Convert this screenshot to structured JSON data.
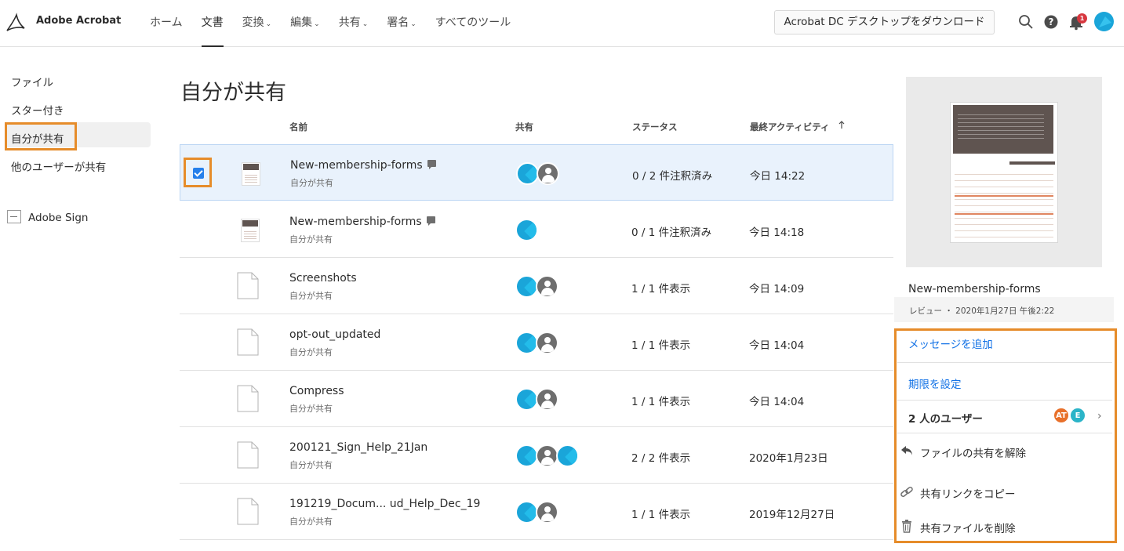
{
  "app": {
    "brand": "Adobe Acrobat",
    "logo_icon": "acrobat-logo-icon"
  },
  "nav": {
    "items": [
      {
        "label": "ホーム",
        "has_dropdown": false,
        "active": false
      },
      {
        "label": "文書",
        "has_dropdown": false,
        "active": true
      },
      {
        "label": "変換",
        "has_dropdown": true,
        "active": false
      },
      {
        "label": "編集",
        "has_dropdown": true,
        "active": false
      },
      {
        "label": "共有",
        "has_dropdown": true,
        "active": false
      },
      {
        "label": "署名",
        "has_dropdown": true,
        "active": false
      },
      {
        "label": "すべてのツール",
        "has_dropdown": false,
        "active": false
      }
    ],
    "download_label": "Acrobat DC デスクトップをダウンロード",
    "notification_count": "1"
  },
  "sidebar": {
    "items": [
      {
        "label": "ファイル"
      },
      {
        "label": "スター付き"
      },
      {
        "label": "自分が共有"
      },
      {
        "label": "他のユーザーが共有"
      }
    ],
    "sign_label": "Adobe Sign"
  },
  "main": {
    "title": "自分が共有",
    "columns": {
      "name": "名前",
      "shared": "共有",
      "status": "ステータス",
      "activity": "最終アクティビティ",
      "sort_icon": "arrow-up-icon"
    },
    "rows": [
      {
        "name": "New-membership-forms",
        "sub": "自分が共有",
        "status": "0 / 2 件注釈済み",
        "activity": "今日 14:22",
        "thumb": "pdf",
        "comment": true,
        "avatars": [
          "cyan",
          "gray"
        ],
        "selected": true
      },
      {
        "name": "New-membership-forms",
        "sub": "自分が共有",
        "status": "0 / 1 件注釈済み",
        "activity": "今日 14:18",
        "thumb": "pdf",
        "comment": true,
        "avatars": [
          "cyan"
        ],
        "selected": false
      },
      {
        "name": "Screenshots",
        "sub": "自分が共有",
        "status": "1 / 1 件表示",
        "activity": "今日 14:09",
        "thumb": "file",
        "comment": false,
        "avatars": [
          "cyan",
          "gray"
        ],
        "selected": false
      },
      {
        "name": "opt-out_updated",
        "sub": "自分が共有",
        "status": "1 / 1 件表示",
        "activity": "今日 14:04",
        "thumb": "file",
        "comment": false,
        "avatars": [
          "cyan",
          "gray"
        ],
        "selected": false
      },
      {
        "name": "Compress",
        "sub": "自分が共有",
        "status": "1 / 1 件表示",
        "activity": "今日 14:04",
        "thumb": "file",
        "comment": false,
        "avatars": [
          "cyan",
          "gray"
        ],
        "selected": false
      },
      {
        "name": "200121_Sign_Help_21Jan",
        "sub": "自分が共有",
        "status": "2 / 2 件表示",
        "activity": "2020年1月23日",
        "thumb": "file",
        "comment": false,
        "avatars": [
          "cyan",
          "gray",
          "cyan"
        ],
        "selected": false
      },
      {
        "name": "191219_Docum... ud_Help_Dec_19",
        "sub": "自分が共有",
        "status": "1 / 1 件表示",
        "activity": "2019年12月27日",
        "thumb": "file",
        "comment": false,
        "avatars": [
          "cyan",
          "gray"
        ],
        "selected": false
      }
    ]
  },
  "panel": {
    "file_name": "New-membership-forms",
    "meta": "レビュー ・ 2020年1月27日 午後2:22",
    "add_message": "メッセージを追加",
    "set_deadline": "期限を設定",
    "users_label": "2 人のユーザー",
    "user_badges": [
      {
        "initials": "AT",
        "color": "#e8702a"
      },
      {
        "initials": "E",
        "color": "#2bb4c8"
      }
    ],
    "unshare": "ファイルの共有を解除",
    "copy_link": "共有リンクをコピー",
    "delete": "共有ファイルを削除"
  },
  "colors": {
    "accent": "#1473e6",
    "highlight": "#e68c2a",
    "selected_row": "#e9f2fc"
  }
}
